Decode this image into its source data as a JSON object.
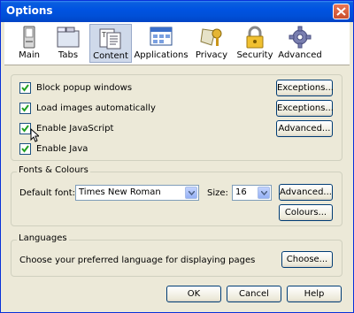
{
  "window": {
    "title": "Options"
  },
  "panes": [
    {
      "label": "Main",
      "icon": "main-icon"
    },
    {
      "label": "Tabs",
      "icon": "tabs-icon"
    },
    {
      "label": "Content",
      "icon": "content-icon",
      "selected": true
    },
    {
      "label": "Applications",
      "icon": "applications-icon"
    },
    {
      "label": "Privacy",
      "icon": "privacy-icon"
    },
    {
      "label": "Security",
      "icon": "security-icon"
    },
    {
      "label": "Advanced",
      "icon": "advanced-icon"
    }
  ],
  "content": {
    "block_popups": {
      "label": "Block popup windows",
      "checked": true,
      "button": "Exceptions..."
    },
    "load_images": {
      "label": "Load images automatically",
      "checked": true,
      "button": "Exceptions..."
    },
    "enable_js": {
      "label": "Enable JavaScript",
      "checked": true,
      "button": "Advanced..."
    },
    "enable_java": {
      "label": "Enable Java",
      "checked": true
    }
  },
  "fonts": {
    "legend": "Fonts & Colours",
    "default_font_label": "Default font:",
    "default_font_value": "Times New Roman",
    "size_label": "Size:",
    "size_value": "16",
    "advanced_button": "Advanced...",
    "colours_button": "Colours..."
  },
  "languages": {
    "legend": "Languages",
    "description": "Choose your preferred language for displaying pages",
    "choose_button": "Choose..."
  },
  "footer": {
    "ok": "OK",
    "cancel": "Cancel",
    "help": "Help"
  },
  "colors": {
    "titlebar": "#0054e3",
    "selected_pane": "#cfd9ea",
    "dialog_bg": "#ece9d8"
  }
}
